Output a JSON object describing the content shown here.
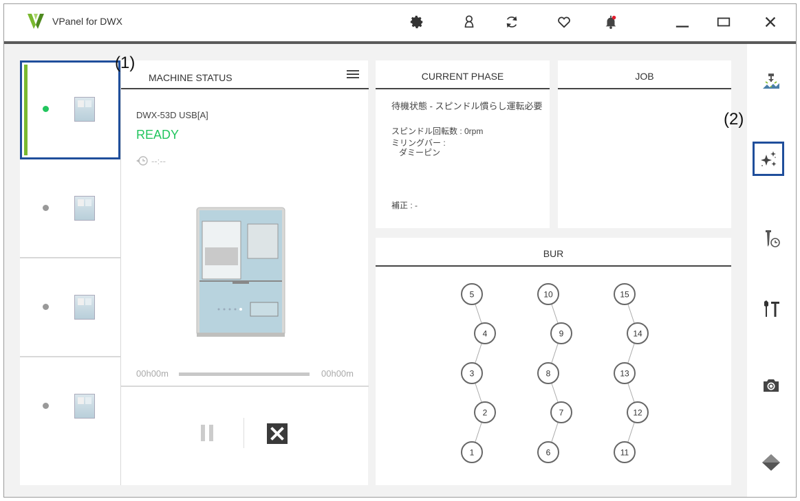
{
  "app": {
    "title": "VPanel for DWX",
    "brand_color": "#7ab92f",
    "accent_color": "#1f4e9b"
  },
  "titlebar": {
    "icons": [
      "settings-gear-icon",
      "user-icon",
      "refresh-icon",
      "heart-icon",
      "notification-bell-icon"
    ],
    "window_controls": [
      "minimize-icon",
      "maximize-icon",
      "close-icon"
    ]
  },
  "annotations": {
    "a1": "(1)",
    "a2": "(2)"
  },
  "machine_status": {
    "header": "MACHINE STATUS",
    "model": "DWX-53D USB[A]",
    "state": "READY",
    "state_color": "#22c55e",
    "time": "--:--",
    "progress_start": "00h00m",
    "progress_end": "00h00m",
    "progress": 0
  },
  "machines": [
    {
      "status": "ready",
      "selected": true
    },
    {
      "status": "idle",
      "selected": false
    },
    {
      "status": "idle",
      "selected": false
    },
    {
      "status": "idle",
      "selected": false
    }
  ],
  "current_phase": {
    "header": "CURRENT PHASE",
    "line1": "待機状態 - スピンドル慣らし運転必要",
    "line2": "スピンドル回転数 : 0rpm",
    "line3": "ミリングバー :",
    "line3_value": "ダミーピン",
    "line4": "補正 : -"
  },
  "job": {
    "header": "JOB"
  },
  "bur": {
    "header": "BUR",
    "slots": [
      5,
      4,
      3,
      2,
      1,
      10,
      9,
      8,
      7,
      6,
      15,
      14,
      13,
      12,
      11
    ]
  },
  "sidebar": {
    "items": [
      "milling-icon",
      "sparkle-icon",
      "bur-timer-icon",
      "tools-icon",
      "camera-icon",
      "diamond-icon"
    ]
  }
}
